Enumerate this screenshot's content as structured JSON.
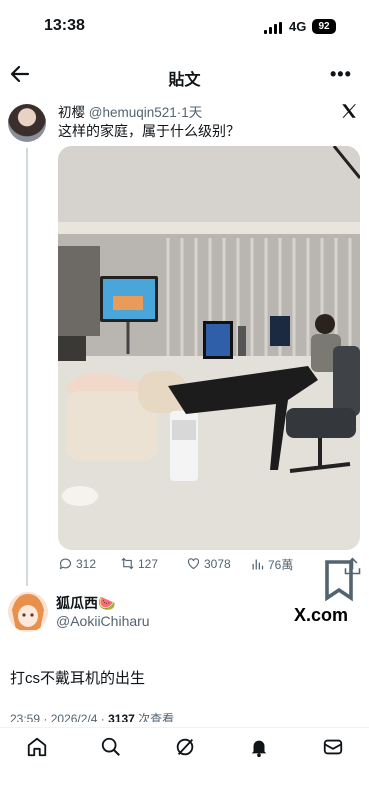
{
  "status_bar": {
    "time": "13:38",
    "network": "4G",
    "battery": "92"
  },
  "header": {
    "title": "貼文"
  },
  "tweet": {
    "author_name": "初樱",
    "handle": "@hemuqin521",
    "separator": "·",
    "time": "1天",
    "text": "这样的家庭，属于什么级别？",
    "stats": {
      "replies": "312",
      "retweets": "127",
      "likes": "3078",
      "views": "76萬"
    }
  },
  "reply": {
    "name": "狐瓜西🍉",
    "handle": "@AokiiChiharu",
    "brand": "X.com",
    "text": "打cs不戴耳机的出生"
  },
  "meta": {
    "time": "23:59",
    "separator": "·",
    "date": "2026/2/4",
    "separator2": "·",
    "views_count": "3137",
    "views_label": "次查看"
  },
  "icons": [
    "back-arrow-icon",
    "more-icon",
    "x-logo-icon",
    "reply-icon",
    "retweet-icon",
    "like-icon",
    "views-icon",
    "bookmark-icon",
    "share-icon",
    "home-icon",
    "search-icon",
    "grok-icon",
    "notifications-icon",
    "messages-icon"
  ],
  "colors": {
    "text": "#0f1419",
    "muted": "#536471",
    "line": "#cfd9de"
  }
}
